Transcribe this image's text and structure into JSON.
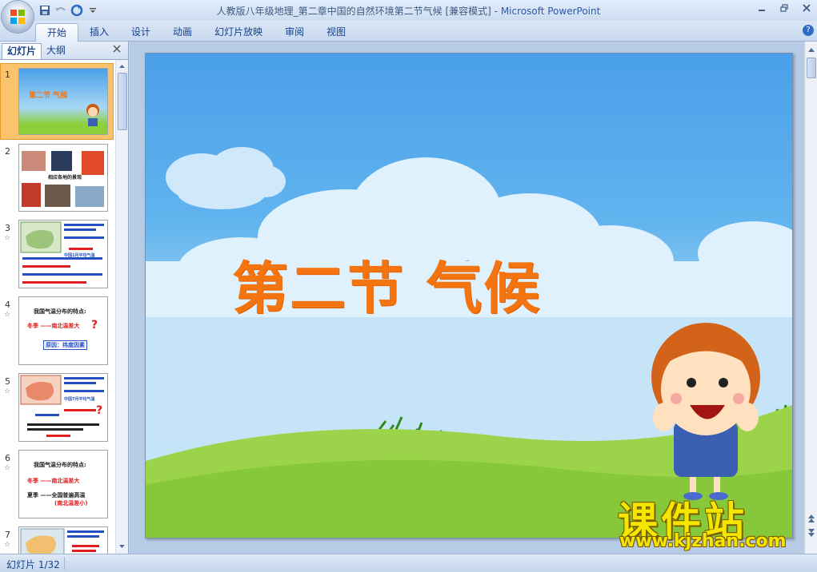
{
  "window": {
    "title": "人教版八年级地理_第二章中国的自然环境第二节气候 [兼容模式]",
    "title_separator": " - ",
    "app_name": "Microsoft PowerPoint"
  },
  "ribbon": {
    "tabs": [
      {
        "label": "开始",
        "active": true
      },
      {
        "label": "插入",
        "active": false
      },
      {
        "label": "设计",
        "active": false
      },
      {
        "label": "动画",
        "active": false
      },
      {
        "label": "幻灯片放映",
        "active": false
      },
      {
        "label": "审阅",
        "active": false
      },
      {
        "label": "视图",
        "active": false
      }
    ],
    "help": "?"
  },
  "left_pane": {
    "tabs": {
      "slides": "幻灯片",
      "outline": "大纲"
    },
    "thumbnails": [
      {
        "num": "1",
        "selected": true,
        "text": "第二节 气候"
      },
      {
        "num": "2",
        "selected": false,
        "text": "相应各地的景观"
      },
      {
        "num": "3",
        "selected": false,
        "text": "中国1月平均气温"
      },
      {
        "num": "4",
        "selected": false,
        "line1": "我国气温分布的特点:",
        "line2": "冬季 ——南北温差大",
        "line3": "原因：纬度因素"
      },
      {
        "num": "5",
        "selected": false,
        "text": "中国7月平均气温"
      },
      {
        "num": "6",
        "selected": false,
        "line1": "我国气温分布的特点:",
        "line2": "冬季 ——南北温差大",
        "line3": "夏季 ——全国普遍高温",
        "line4": "(南北温差小)"
      },
      {
        "num": "7",
        "selected": false,
        "text": ""
      }
    ]
  },
  "slide": {
    "title": "第二节 气候"
  },
  "watermark": {
    "chinese": "课件站",
    "url": "www.kjzhan.com"
  },
  "status": {
    "slide_indicator": "幻灯片 1/32"
  },
  "colors": {
    "title_orange": "#f47410",
    "sky_blue": "#4aa0ea",
    "grass_green": "#8ccf3a",
    "selection": "#fbc46c"
  }
}
